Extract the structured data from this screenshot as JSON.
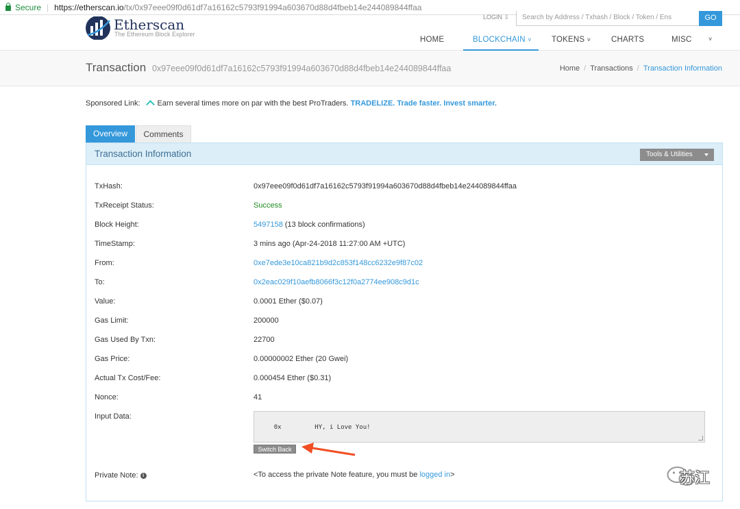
{
  "browser": {
    "secure_label": "Secure",
    "url_host": "https://etherscan.io",
    "url_path": "/tx/0x97eee09f0d61df7a16162c5793f91994a603670d88d4fbeb14e244089844ffaa"
  },
  "header": {
    "logo_title": "Etherscan",
    "logo_subtitle": "The Ethereum Block Explorer",
    "login": "LOGIN ⇩",
    "search_placeholder": "Search by Address / Txhash / Block / Token / Ens",
    "go_label": "GO",
    "nav": {
      "home": "HOME",
      "blockchain": "BLOCKCHAIN",
      "tokens": "TOKENS",
      "charts": "CHARTS",
      "misc": "MISC"
    },
    "chevron": "˅"
  },
  "page": {
    "title": "Transaction",
    "hash": "0x97eee09f0d61df7a16162c5793f91994a603670d88d4fbeb14e244089844ffaa",
    "breadcrumbs": [
      "Home",
      "Transactions",
      "Transaction Information"
    ],
    "crumb_sep": "/"
  },
  "sponsor": {
    "label": "Sponsored Link:",
    "text": "Earn several times more on par with the best ProTraders.",
    "link": "TRADELIZE. Trade faster. Invest smarter."
  },
  "tabs": {
    "overview": "Overview",
    "comments": "Comments"
  },
  "panel": {
    "title": "Transaction Information",
    "tools": "Tools & Utilities"
  },
  "details": {
    "txhash": {
      "label": "TxHash:",
      "value": "0x97eee09f0d61df7a16162c5793f91994a603670d88d4fbeb14e244089844ffaa"
    },
    "status": {
      "label": "TxReceipt Status:",
      "value": "Success"
    },
    "block": {
      "label": "Block Height:",
      "value": "5497158",
      "suffix": " (13 block confirmations)"
    },
    "timestamp": {
      "label": "TimeStamp:",
      "value": "3 mins ago (Apr-24-2018 11:27:00 AM +UTC)"
    },
    "from": {
      "label": "From:",
      "value": "0xe7ede3e10ca821b9d2c853f148cc6232e9f87c02"
    },
    "to": {
      "label": "To:",
      "value": "0x2eac029f10aefb8066f3c12f0a2774ee908c9d1c"
    },
    "value": {
      "label": "Value:",
      "value": "0.0001 Ether ($0.07)"
    },
    "gas_limit": {
      "label": "Gas Limit:",
      "value": "200000"
    },
    "gas_used": {
      "label": "Gas Used By Txn:",
      "value": "22700"
    },
    "gas_price": {
      "label": "Gas Price:",
      "value": "0.00000002 Ether (20 Gwei)"
    },
    "fee": {
      "label": "Actual Tx Cost/Fee:",
      "value": "0.000454 Ether ($0.31)"
    },
    "nonce": {
      "label": "Nonce:",
      "value": "41"
    },
    "input": {
      "label": "Input Data:",
      "value": "0x         HY, i Love You!",
      "switch_label": "Switch Back"
    },
    "private_note": {
      "label": "Private Note:",
      "info_icon": "i",
      "prefix": "<To access the private Note feature, you must be ",
      "link": "logged in",
      "suffix": ">"
    }
  },
  "watermark": {
    "text": "苏江"
  },
  "colors": {
    "accent": "#3498db",
    "success": "#1e8c21",
    "arrow": "#f04e23",
    "panel_head": "#dceef8"
  }
}
